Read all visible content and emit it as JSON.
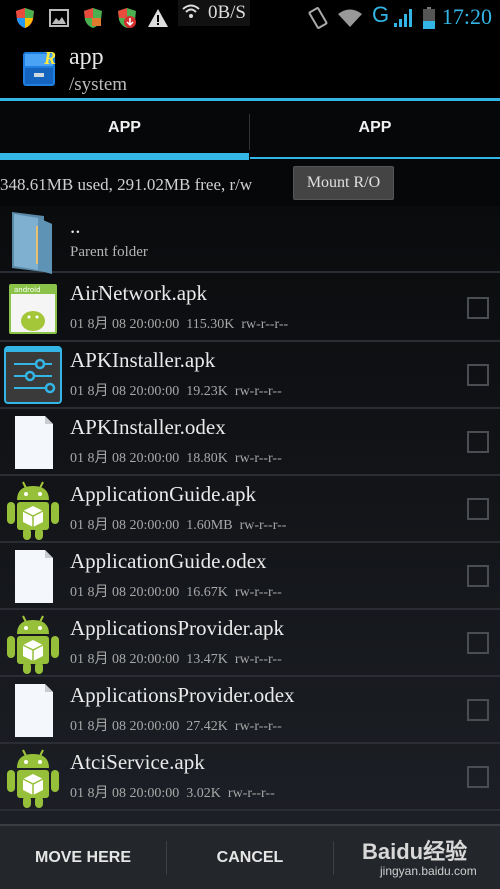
{
  "status_bar": {
    "left_icons": [
      "shield-icon",
      "image-icon",
      "shield-lock-icon",
      "shield-download-icon",
      "warning-icon"
    ],
    "net_speed": "0B/S",
    "right_icons": [
      "vibrate-icon",
      "wifi-icon",
      "network-type-icon",
      "signal-icon",
      "battery-icon"
    ],
    "network_type": "G",
    "time": "17:20",
    "accent_color": "#33b5e5"
  },
  "action_bar": {
    "app_icon": "root-explorer-icon",
    "title": "app",
    "subtitle": "/system"
  },
  "tabs": [
    {
      "label": "APP",
      "active": true
    },
    {
      "label": "APP",
      "active": false
    }
  ],
  "info": {
    "usage": "348.61MB used, 291.02MB free, r/w",
    "mount_button": "Mount R/O"
  },
  "files": [
    {
      "type": "parent",
      "icon": "folder-icon",
      "name": "..",
      "meta": "Parent folder"
    },
    {
      "type": "file",
      "icon": "apk-generic-icon",
      "name": "AirNetwork.apk",
      "date": "01 8月 08 20:00:00",
      "size": "115.30K",
      "perms": "rw-r--r--",
      "checked": false
    },
    {
      "type": "file",
      "icon": "settings-sliders-icon",
      "name": "APKInstaller.apk",
      "date": "01 8月 08 20:00:00",
      "size": "19.23K",
      "perms": "rw-r--r--",
      "checked": false
    },
    {
      "type": "file",
      "icon": "blank-file-icon",
      "name": "APKInstaller.odex",
      "date": "01 8月 08 20:00:00",
      "size": "18.80K",
      "perms": "rw-r--r--",
      "checked": false
    },
    {
      "type": "file",
      "icon": "android-package-icon",
      "name": "ApplicationGuide.apk",
      "date": "01 8月 08 20:00:00",
      "size": "1.60MB",
      "perms": "rw-r--r--",
      "checked": false
    },
    {
      "type": "file",
      "icon": "blank-file-icon",
      "name": "ApplicationGuide.odex",
      "date": "01 8月 08 20:00:00",
      "size": "16.67K",
      "perms": "rw-r--r--",
      "checked": false
    },
    {
      "type": "file",
      "icon": "android-package-icon",
      "name": "ApplicationsProvider.apk",
      "date": "01 8月 08 20:00:00",
      "size": "13.47K",
      "perms": "rw-r--r--",
      "checked": false
    },
    {
      "type": "file",
      "icon": "blank-file-icon",
      "name": "ApplicationsProvider.odex",
      "date": "01 8月 08 20:00:00",
      "size": "27.42K",
      "perms": "rw-r--r--",
      "checked": false
    },
    {
      "type": "file",
      "icon": "android-package-icon",
      "name": "AtciService.apk",
      "date": "01 8月 08 20:00:00",
      "size": "3.02K",
      "perms": "rw-r--r--",
      "checked": false
    }
  ],
  "bottom_bar": {
    "move_here": "MOVE HERE",
    "cancel": "CANCEL"
  },
  "watermark": {
    "brand": "Baidu经验",
    "url": "jingyan.baidu.com"
  }
}
